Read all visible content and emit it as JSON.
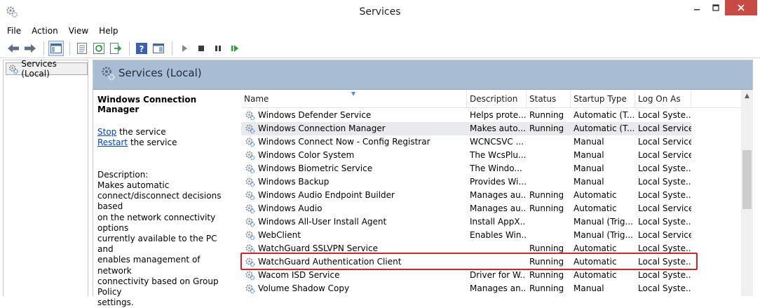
{
  "window": {
    "title": "Services"
  },
  "menu": [
    "File",
    "Action",
    "View",
    "Help"
  ],
  "toolbar_icons": [
    "back-arrow-icon",
    "forward-arrow-icon",
    "show-hide-tree-icon",
    "properties-icon",
    "refresh-icon",
    "export-list-icon",
    "help-icon",
    "view-pane-icon",
    "play-icon",
    "stop-icon",
    "pause-icon",
    "restart-icon"
  ],
  "tree": {
    "item_label": "Services (Local)"
  },
  "banner": {
    "title": "Services (Local)"
  },
  "details": {
    "service_name": "Windows Connection Manager",
    "stop_link": "Stop",
    "stop_suffix": " the service",
    "restart_link": "Restart",
    "restart_suffix": " the service",
    "description_label": "Description:",
    "description_text": "Makes automatic\nconnect/disconnect decisions based\non the network connectivity options\ncurrently available to the PC and\nenables management of network\nconnectivity based on Group Policy\nsettings."
  },
  "columns": {
    "name": "Name",
    "description": "Description",
    "status": "Status",
    "startup": "Startup Type",
    "logon": "Log On As"
  },
  "services": [
    {
      "name": "Windows Defender Service",
      "description": "Helps prote...",
      "status": "Running",
      "startup": "Automatic (T...",
      "logon": "Local Syste..."
    },
    {
      "name": "Windows Connection Manager",
      "description": "Makes auto...",
      "status": "Running",
      "startup": "Automatic (T...",
      "logon": "Local Service"
    },
    {
      "name": "Windows Connect Now - Config Registrar",
      "description": "WCNCSVC ...",
      "status": "",
      "startup": "Manual",
      "logon": "Local Service"
    },
    {
      "name": "Windows Color System",
      "description": "The WcsPlu...",
      "status": "",
      "startup": "Manual",
      "logon": "Local Service"
    },
    {
      "name": "Windows Biometric Service",
      "description": "The Windo...",
      "status": "",
      "startup": "Manual",
      "logon": "Local Syste..."
    },
    {
      "name": "Windows Backup",
      "description": "Provides Wi...",
      "status": "",
      "startup": "Manual",
      "logon": "Local Syste..."
    },
    {
      "name": "Windows Audio Endpoint Builder",
      "description": "Manages au...",
      "status": "Running",
      "startup": "Automatic",
      "logon": "Local Syste..."
    },
    {
      "name": "Windows Audio",
      "description": "Manages au...",
      "status": "Running",
      "startup": "Automatic",
      "logon": "Local Service"
    },
    {
      "name": "Windows All-User Install Agent",
      "description": "Install AppX...",
      "status": "",
      "startup": "Manual (Trig...",
      "logon": "Local Syste..."
    },
    {
      "name": "WebClient",
      "description": "Enables Win...",
      "status": "",
      "startup": "Manual (Trig...",
      "logon": "Local Service"
    },
    {
      "name": "WatchGuard SSLVPN Service",
      "description": "",
      "status": "Running",
      "startup": "Automatic",
      "logon": "Local Syste..."
    },
    {
      "name": "WatchGuard Authentication Client",
      "description": "",
      "status": "Running",
      "startup": "Automatic",
      "logon": "Local Syste..."
    },
    {
      "name": "Wacom ISD Service",
      "description": "Driver for W...",
      "status": "Running",
      "startup": "Automatic",
      "logon": "Local Syste..."
    },
    {
      "name": "Volume Shadow Copy",
      "description": "Manages an...",
      "status": "Running",
      "startup": "Manual",
      "logon": "Local Syste..."
    },
    {
      "name": "",
      "description": "",
      "status": "",
      "startup": "",
      "logon": ""
    }
  ],
  "selected_row_index": 1,
  "highlighted_row_index": 11,
  "colors": {
    "banner": "#a8bcd3",
    "highlight_border": "#d2232a",
    "link": "#0645ad",
    "close_button": "#c74a45"
  }
}
